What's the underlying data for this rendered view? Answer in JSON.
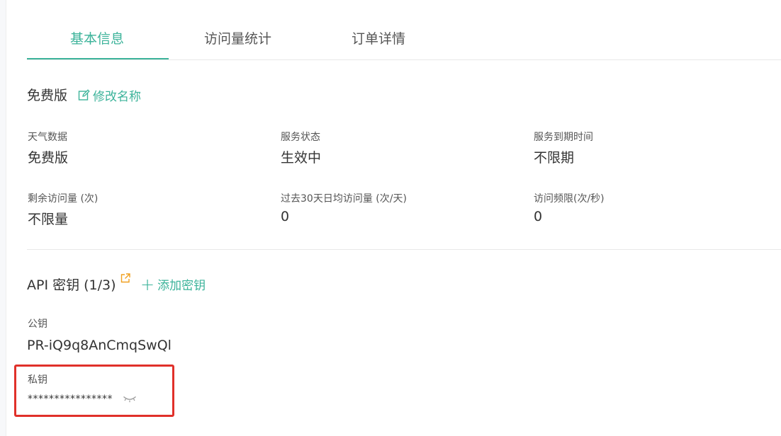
{
  "tabs": [
    {
      "label": "基本信息",
      "active": true
    },
    {
      "label": "访问量统计",
      "active": false
    },
    {
      "label": "订单详情",
      "active": false
    }
  ],
  "plan": {
    "name": "免费版",
    "rename_label": "修改名称"
  },
  "info": {
    "weather_data_label": "天气数据",
    "weather_data_value": "免费版",
    "service_status_label": "服务状态",
    "service_status_value": "生效中",
    "expiry_label": "服务到期时间",
    "expiry_value": "不限期",
    "remaining_label": "剩余访问量 (次)",
    "remaining_value": "不限量",
    "avg30_label": "过去30天日均访问量 (次/天)",
    "avg30_value": "0",
    "rate_label": "访问频限(次/秒)",
    "rate_value": "0"
  },
  "api": {
    "title": "API 密钥 (1/3)",
    "add_label": "添加密钥",
    "public_key_label": "公钥",
    "public_key_value": "PR-iQ9q8AnCmqSwQl",
    "private_key_label": "私钥",
    "private_key_value": "****************"
  },
  "colors": {
    "accent": "#3cb39a",
    "highlight_box": "#e0302a",
    "external_link_icon": "#f0a020"
  },
  "icons": {
    "rename": "edit-icon",
    "api_external": "external-link-icon",
    "add": "plus-icon",
    "private_key_toggle": "eye-closed-icon"
  }
}
